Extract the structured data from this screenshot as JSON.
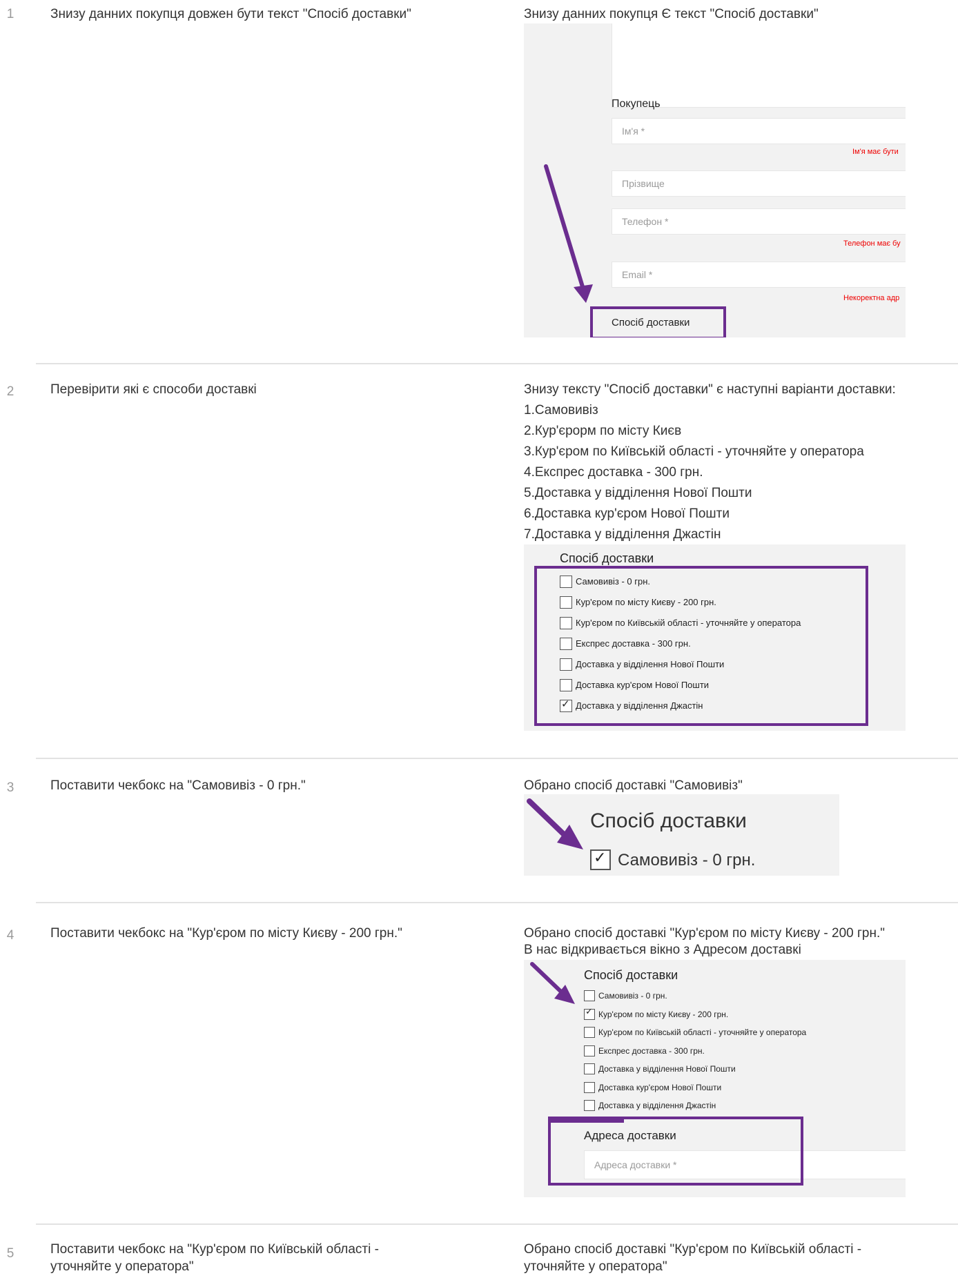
{
  "rows": [
    {
      "num": "1",
      "step": "Знизу данних покупця довжен бути текст \"Спосіб доставки\"",
      "expected": [
        "Знизу данних покупця Є текст \"Спосіб доставки\""
      ]
    },
    {
      "num": "2",
      "step": "Перевірити які є способи доставкі",
      "expected": [
        "Знизу тексту \"Спосіб доставки\" є наступні варіанти доставки:",
        "1.Самовивіз",
        "2.Кур'єрорм по місту Києв",
        "3.Кур'єром по Київській області - уточняйте у оператора",
        "4.Експрес доставка - 300 грн.",
        "5.Доставка у відділення Нової Пошти",
        "6.Доставка кур'єром Нової Пошти",
        "7.Доставка у відділення Джастін"
      ]
    },
    {
      "num": "3",
      "step": "Поставити чекбокс на \"Самовивіз - 0 грн.\"",
      "expected": [
        "Обрано спосіб доставкі \"Самовивіз\""
      ]
    },
    {
      "num": "4",
      "step": "Поставити чекбокс на \"Кур'єром по місту Києву - 200 грн.\"",
      "expected": [
        "Обрано спосіб доставкі \"Кур'єром по місту Києву - 200 грн.\"",
        "В нас відкривається вікно з Адресом доставкі"
      ]
    },
    {
      "num": "5",
      "step": "Поставити чекбокс на \"Кур'єром по Київській області -",
      "step2": "уточняйте у оператора\"",
      "expected": [
        "Обрано спосіб доставкі \"Кур'єром по Київській області -",
        "уточняйте у оператора\""
      ]
    }
  ],
  "form1": {
    "section": "Покупець",
    "name_ph": "Ім'я *",
    "name_err": "Ім'я має бути",
    "surname_ph": "Прізвище",
    "phone_ph": "Телефон *",
    "phone_err": "Телефон має бу",
    "email_ph": "Email *",
    "email_err": "Некоректна адр",
    "delivery": "Спосіб доставки"
  },
  "delivery_title": "Спосіб доставки",
  "options": [
    "Самовивіз - 0 грн.",
    "Кур'єром по місту Києву - 200 грн.",
    "Кур'єром по Київській області - уточняйте у оператора",
    "Експрес доставка - 300 грн.",
    "Доставка у відділення Нової Пошти",
    "Доставка кур'єром Нової Пошти",
    "Доставка у відділення Джастін"
  ],
  "shot2_checked": 6,
  "shot3": {
    "title": "Спосіб доставки",
    "option": "Самовивіз - 0 грн."
  },
  "shot4": {
    "checked": 1,
    "address_title": "Адреса доставки",
    "address_ph": "Адреса доставки *"
  },
  "colors": {
    "highlight": "#6b2d8f",
    "error": "#e00000",
    "separator": "#e2e2e2"
  }
}
